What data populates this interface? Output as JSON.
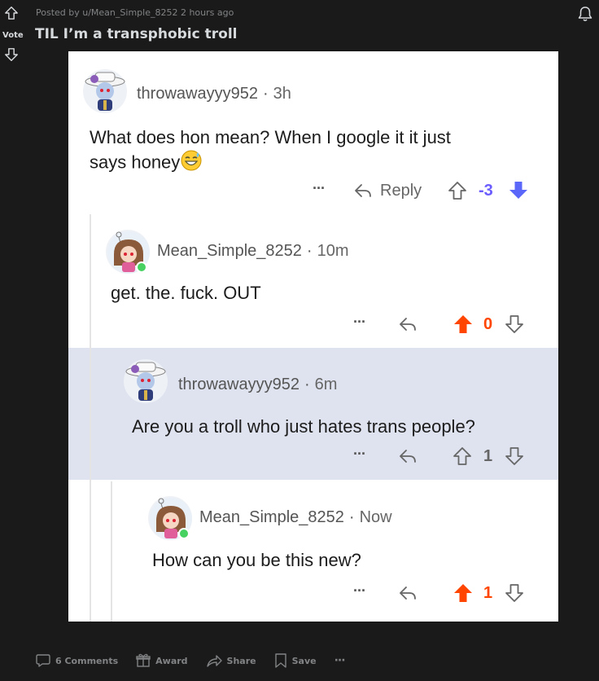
{
  "post": {
    "meta": "Posted by u/Mean_Simple_8252 2 hours ago",
    "vote_label": "Vote",
    "title": "TIL I’m a transphobic troll"
  },
  "comments": [
    {
      "user": "throwawayyy952",
      "sep": "·",
      "time": "3h",
      "text_line1": "What does hon mean? When I google it it just",
      "text_line2": "says honey",
      "more": "···",
      "reply": "Reply",
      "score": "-3",
      "vote_state": "downvoted"
    },
    {
      "user": "Mean_Simple_8252",
      "sep": "·",
      "time": "10m",
      "text": "get. the. fuck. OUT",
      "more": "···",
      "score": "0",
      "vote_state": "upvoted"
    },
    {
      "user": "throwawayyy952",
      "sep": "·",
      "time": "6m",
      "text": "Are you a troll who just hates trans people?",
      "more": "···",
      "score": "1",
      "vote_state": "none"
    },
    {
      "user": "Mean_Simple_8252",
      "sep": "·",
      "time": "Now",
      "text": "How can you be this new?",
      "more": "···",
      "score": "1",
      "vote_state": "upvoted"
    }
  ],
  "footer": {
    "comments": "6 Comments",
    "award": "Award",
    "share": "Share",
    "save": "Save",
    "more": "···"
  },
  "colors": {
    "upvote": "#ff4500",
    "downvote": "#7193ff",
    "highlight": "#dfe3ef",
    "online": "#46d160"
  }
}
